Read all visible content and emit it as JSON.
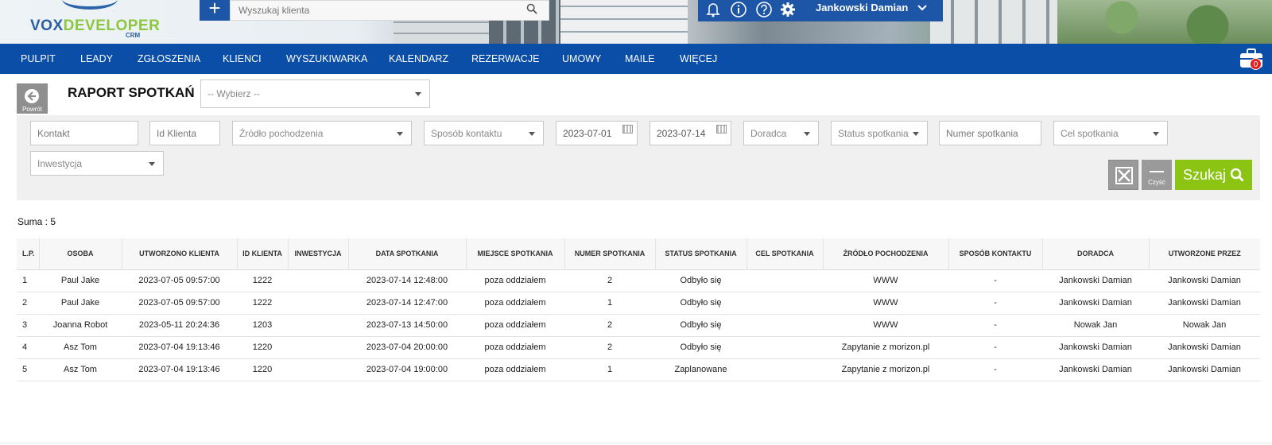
{
  "header": {
    "logo_main": "VOX",
    "logo_accent": "DEVELOPER",
    "logo_sub": "CRM",
    "add_label": "+",
    "search_placeholder": "Wyszukaj klienta",
    "user_name": "Jankowski Damian"
  },
  "nav": {
    "items": [
      "PULPIT",
      "LEADY",
      "ZGŁOSZENIA",
      "KLIENCI",
      "WYSZUKIWARKA",
      "KALENDARZ",
      "REZERWACJE",
      "UMOWY",
      "MAILE",
      "WIĘCEJ"
    ],
    "cart_count": "0"
  },
  "page": {
    "back_label": "Powrót",
    "title": "RAPORT SPOTKAŃ",
    "report_select": "-- Wybierz --"
  },
  "filters": {
    "kontakt": "Kontakt",
    "id_klienta": "Id Klienta",
    "zrodlo": "Źródło pochodzenia",
    "sposob": "Sposób kontaktu",
    "date_from": "2023-07-01",
    "date_to": "2023-07-14",
    "doradca": "Doradca",
    "status": "Status spotkania",
    "numer": "Numer spotkania",
    "cel": "Cel spotkania",
    "inwestycja": "Inwestycja",
    "clear_label": "Czyść",
    "search_label": "Szukaj"
  },
  "sum_label": "Suma : 5",
  "table": {
    "columns": [
      "L.P.",
      "OSOBA",
      "UTWORZONO KLIENTA",
      "ID KLIENTA",
      "INWESTYCJA",
      "DATA SPOTKANIA",
      "MIEJSCE SPOTKANIA",
      "NUMER SPOTKANIA",
      "STATUS SPOTKANIA",
      "CEL SPOTKANIA",
      "ŹRÓDŁO POCHODZENIA",
      "SPOSÓB KONTAKTU",
      "DORADCA",
      "UTWORZONE PRZEZ"
    ],
    "rows": [
      [
        "1",
        "Paul Jake",
        "2023-07-05 09:57:00",
        "1222",
        "",
        "2023-07-14 12:48:00",
        "poza oddziałem",
        "2",
        "Odbyło się",
        "",
        "WWW",
        "-",
        "Jankowski Damian",
        "Jankowski Damian"
      ],
      [
        "2",
        "Paul Jake",
        "2023-07-05 09:57:00",
        "1222",
        "",
        "2023-07-14 12:47:00",
        "poza oddziałem",
        "1",
        "Odbyło się",
        "",
        "WWW",
        "-",
        "Jankowski Damian",
        "Jankowski Damian"
      ],
      [
        "3",
        "Joanna Robot",
        "2023-05-11 20:24:36",
        "1203",
        "",
        "2023-07-13 14:50:00",
        "poza oddziałem",
        "2",
        "Odbyło się",
        "",
        "WWW",
        "-",
        "Nowak Jan",
        "Nowak Jan"
      ],
      [
        "4",
        "Asz Tom",
        "2023-07-04 19:13:46",
        "1220",
        "",
        "2023-07-04 20:00:00",
        "poza oddziałem",
        "2",
        "Odbyło się",
        "",
        "Zapytanie z morizon.pl",
        "-",
        "Jankowski Damian",
        "Jankowski Damian"
      ],
      [
        "5",
        "Asz Tom",
        "2023-07-04 19:13:46",
        "1220",
        "",
        "2023-07-04 19:00:00",
        "poza oddziałem",
        "1",
        "Zaplanowane",
        "",
        "Zapytanie z morizon.pl",
        "-",
        "Jankowski Damian",
        "Jankowski Damian"
      ]
    ]
  },
  "colors": {
    "brand_blue": "#0a4ea8",
    "search_green": "#8cc414",
    "button_gray": "#9a9a9a",
    "badge_red": "#e02020"
  }
}
